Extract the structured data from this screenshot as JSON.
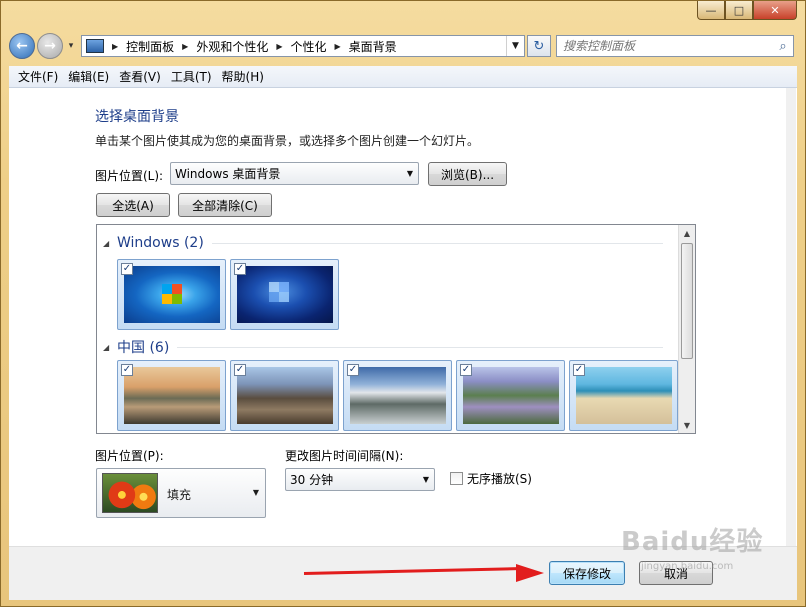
{
  "window": {
    "minimize_glyph": "—",
    "maximize_glyph": "□",
    "close_glyph": "✕"
  },
  "address_bar": {
    "crumbs": [
      "控制面板",
      "外观和个性化",
      "个性化",
      "桌面背景"
    ],
    "search_placeholder": "搜索控制面板"
  },
  "menu": {
    "items": [
      "文件(F)",
      "编辑(E)",
      "查看(V)",
      "工具(T)",
      "帮助(H)"
    ]
  },
  "page": {
    "title": "选择桌面背景",
    "description": "单击某个图片使其成为您的桌面背景，或选择多个图片创建一个幻灯片。",
    "location_label": "图片位置(L):",
    "location_value": "Windows 桌面背景",
    "browse_label": "浏览(B)...",
    "select_all_label": "全选(A)",
    "clear_all_label": "全部清除(C)"
  },
  "gallery": {
    "groups": [
      {
        "name": "Windows (2)",
        "items": [
          {
            "name": "win7-logo",
            "checked": true
          },
          {
            "name": "win7-blue",
            "checked": true
          }
        ]
      },
      {
        "name": "中国 (6)",
        "items": [
          {
            "name": "guilin",
            "checked": true
          },
          {
            "name": "great-wall",
            "checked": true
          },
          {
            "name": "huangshan",
            "checked": true
          },
          {
            "name": "terraces",
            "checked": true
          },
          {
            "name": "beach",
            "checked": true
          }
        ]
      }
    ],
    "check_glyph": "✓"
  },
  "position": {
    "label": "图片位置(P):",
    "value": "填充"
  },
  "interval": {
    "label": "更改图片时间间隔(N):",
    "value": "30 分钟"
  },
  "shuffle": {
    "label": "无序播放(S)",
    "checked": false
  },
  "footer": {
    "save_label": "保存修改",
    "cancel_label": "取消"
  },
  "watermark": {
    "text": "Baidu经验",
    "sub": "jingyan.baidu.com"
  }
}
